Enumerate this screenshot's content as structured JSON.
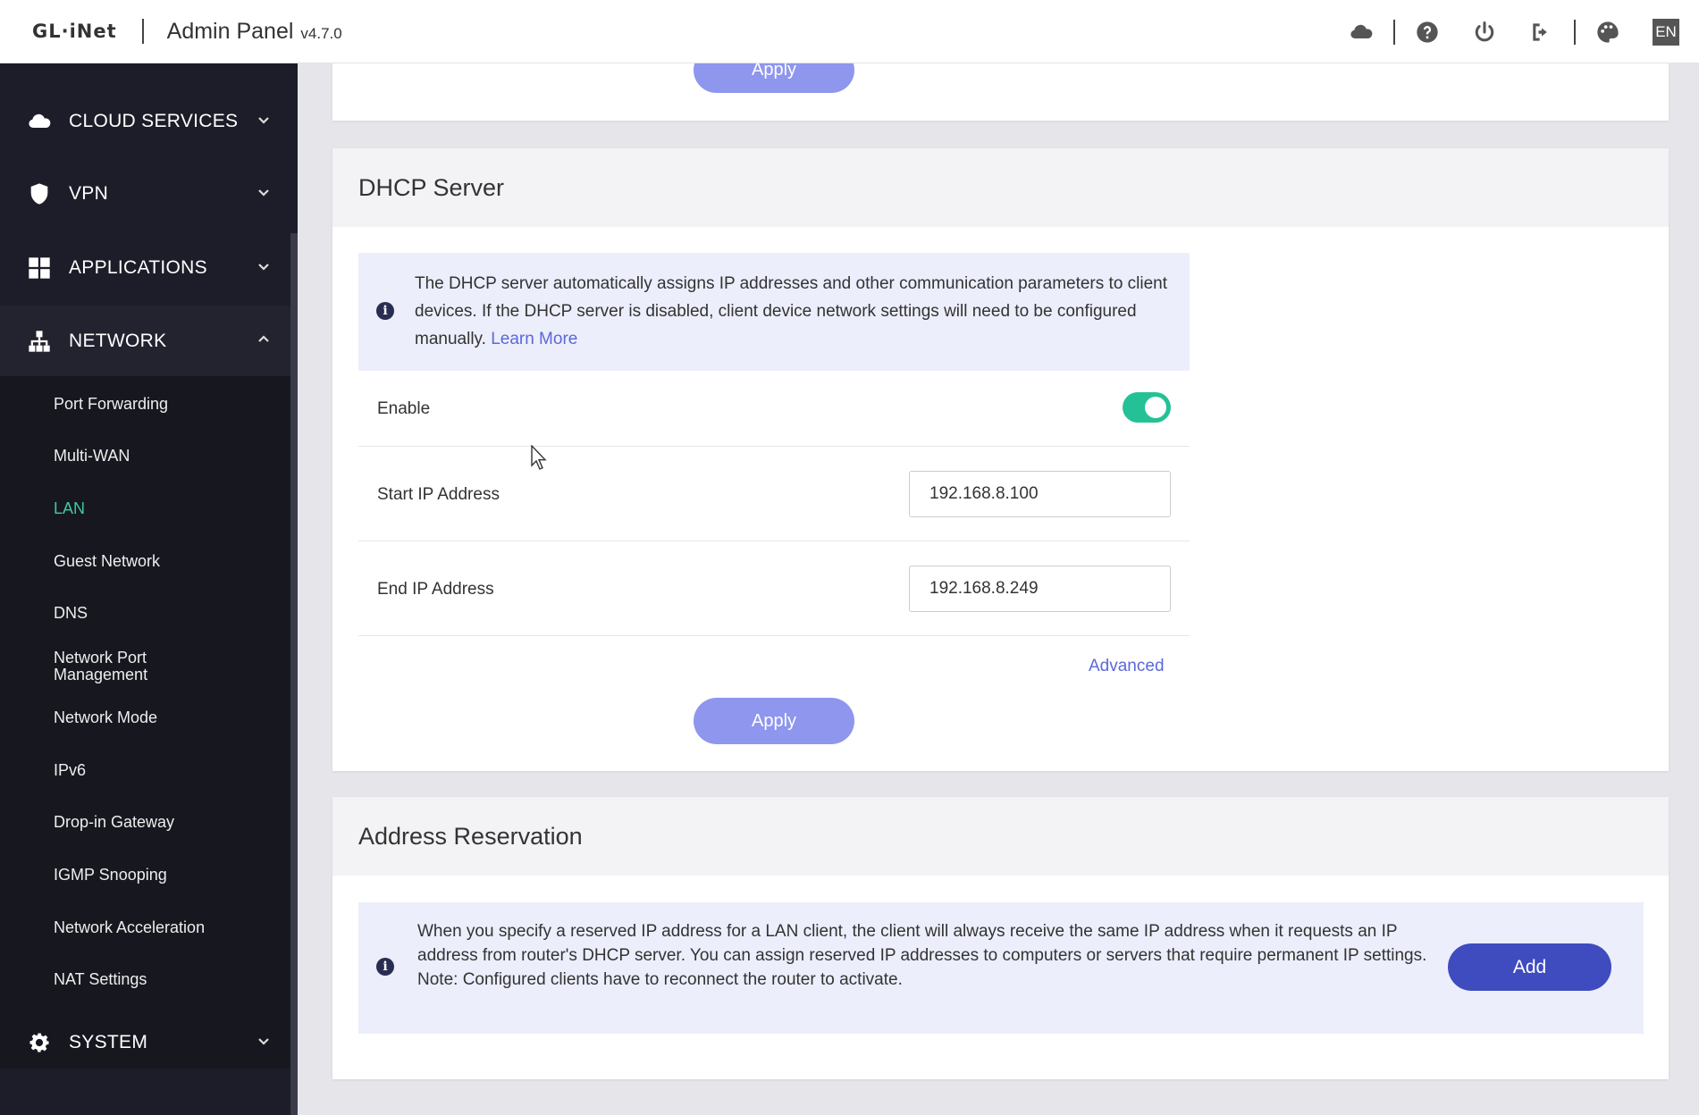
{
  "header": {
    "brand": "GL·iNet",
    "title": "Admin Panel",
    "version": "v4.7.0",
    "icons": [
      "cloud-icon",
      "help-icon",
      "power-icon",
      "logout-icon",
      "palette-icon"
    ],
    "language": "EN"
  },
  "sidebar": {
    "categories": [
      {
        "label": "CLOUD SERVICES",
        "icon": "cloud-icon",
        "expanded": false
      },
      {
        "label": "VPN",
        "icon": "shield-icon",
        "expanded": false
      },
      {
        "label": "APPLICATIONS",
        "icon": "grid-icon",
        "expanded": false
      },
      {
        "label": "NETWORK",
        "icon": "network-icon",
        "expanded": true
      },
      {
        "label": "SYSTEM",
        "icon": "gear-icon",
        "expanded": false
      }
    ],
    "network_items": [
      {
        "label": "Port Forwarding"
      },
      {
        "label": "Multi-WAN"
      },
      {
        "label": "LAN",
        "active": true
      },
      {
        "label": "Guest Network"
      },
      {
        "label": "DNS"
      },
      {
        "label": "Network Port Management"
      },
      {
        "label": "Network Mode"
      },
      {
        "label": "IPv6"
      },
      {
        "label": "Drop-in Gateway"
      },
      {
        "label": "IGMP Snooping"
      },
      {
        "label": "Network Acceleration"
      },
      {
        "label": "NAT Settings"
      }
    ]
  },
  "top_card": {
    "apply_label": "Apply"
  },
  "dhcp": {
    "title": "DHCP Server",
    "info": "The DHCP server automatically assigns IP addresses and other communication parameters to client devices. If the DHCP server is disabled, client device network settings will need to be configured manually.",
    "learn_more": "Learn More",
    "enable_label": "Enable",
    "enabled": true,
    "start_label": "Start IP Address",
    "start_value": "192.168.8.100",
    "end_label": "End IP Address",
    "end_value": "192.168.8.249",
    "advanced": "Advanced",
    "apply_label": "Apply"
  },
  "reservation": {
    "title": "Address Reservation",
    "info": "When you specify a reserved IP address for a LAN client, the client will always receive the same IP address when it requests an IP address from router's DHCP server. You can assign reserved IP addresses to computers or servers that require permanent IP settings.",
    "note": "Note: Configured clients have to reconnect the router to activate.",
    "add_label": "Add"
  },
  "colors": {
    "accent": "#3ec9a7",
    "toggle_on": "#25c196",
    "apply_button": "#8e96ee",
    "add_button": "#3f4cbf",
    "link": "#5c68d8",
    "sidebar_bg": "#1c1d28"
  }
}
